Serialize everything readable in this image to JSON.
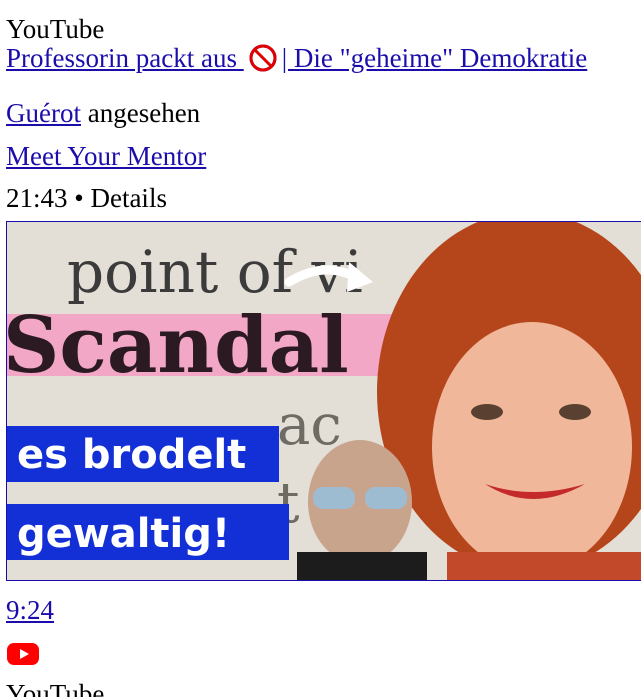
{
  "app": {
    "name": "YouTube"
  },
  "history_item": {
    "title_prefix": "Professorin packt aus",
    "title_suffix": "| Die \"geheime\" Demokratie",
    "channel_link": "Guérot",
    "viewed_label": "angesehen",
    "uploader": "Meet Your Mentor",
    "timestamp": "21:43",
    "separator": "•",
    "details_label": "Details",
    "duration": "9:24",
    "thumbnail": {
      "bg_words": [
        "point of vi",
        "Scandal"
      ],
      "overlay_line1": "es brodelt",
      "overlay_line2": "gewaltig!"
    }
  },
  "footer": {
    "app_name": "YouTube"
  },
  "colors": {
    "link": "#1a0dab",
    "youtube_red": "#ff0000",
    "overlay_blue": "#1330d6",
    "highlight_pink": "#f2a7c6"
  },
  "icons": [
    "prohibited-icon",
    "youtube-logo-icon"
  ]
}
